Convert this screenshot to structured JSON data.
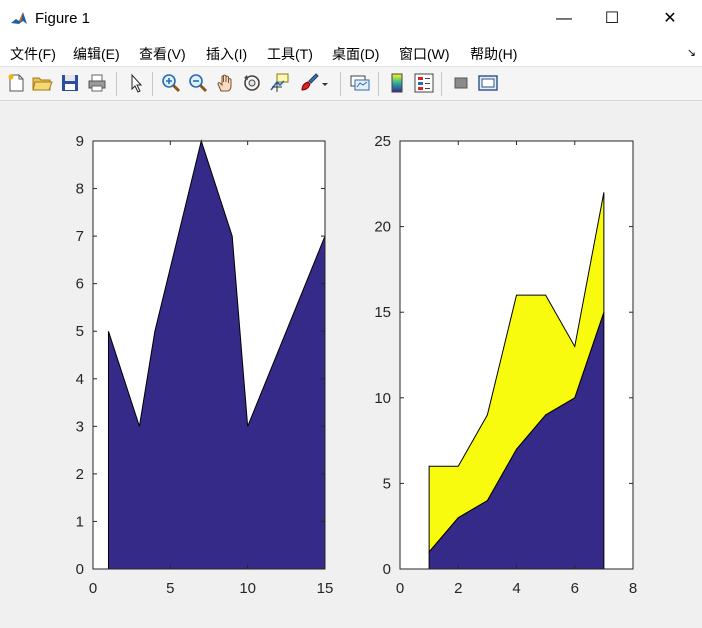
{
  "window": {
    "title": "Figure 1",
    "minimize_glyph": "—",
    "maximize_glyph": "☐",
    "close_glyph": "✕"
  },
  "menu": {
    "items": [
      "文件(F)",
      "编辑(E)",
      "查看(V)",
      "插入(I)",
      "工具(T)",
      "桌面(D)",
      "窗口(W)",
      "帮助(H)"
    ],
    "corner_glyph": "↘"
  },
  "toolbar": {
    "buttons": [
      "new-figure-icon",
      "open-file-icon",
      "save-icon",
      "print-icon",
      "select-arrow-icon",
      "zoom-in-icon",
      "zoom-out-icon",
      "pan-hand-icon",
      "rotate-3d-icon",
      "data-cursor-icon",
      "brush-icon",
      "brush-dropdown-icon",
      "link-plot-icon",
      "colorbar-icon",
      "legend-icon",
      "hide-plot-tools-icon",
      "show-plot-tools-icon"
    ]
  },
  "colors": {
    "area1": "#352a87",
    "area2": "#f9fb0e",
    "axis": "#262626"
  },
  "chart_data": [
    {
      "type": "area",
      "x": [
        1,
        3,
        4,
        7,
        9,
        10,
        15
      ],
      "series": [
        {
          "values": [
            5,
            3,
            5,
            9,
            7,
            3,
            7
          ]
        }
      ],
      "xlim": [
        0,
        15
      ],
      "ylim": [
        0,
        9
      ],
      "xticks": [
        0,
        5,
        10,
        15
      ],
      "yticks": [
        0,
        1,
        2,
        3,
        4,
        5,
        6,
        7,
        8,
        9
      ],
      "grid": false
    },
    {
      "type": "area",
      "stacked": true,
      "x": [
        1,
        2,
        3,
        4,
        5,
        6,
        7
      ],
      "series": [
        {
          "values": [
            1,
            3,
            4,
            7,
            9,
            10,
            15
          ]
        },
        {
          "values": [
            5,
            3,
            5,
            9,
            7,
            3,
            7
          ]
        }
      ],
      "xlim": [
        0,
        8
      ],
      "ylim": [
        0,
        25
      ],
      "xticks": [
        0,
        2,
        4,
        6,
        8
      ],
      "yticks": [
        0,
        5,
        10,
        15,
        20,
        25
      ],
      "grid": false
    }
  ]
}
